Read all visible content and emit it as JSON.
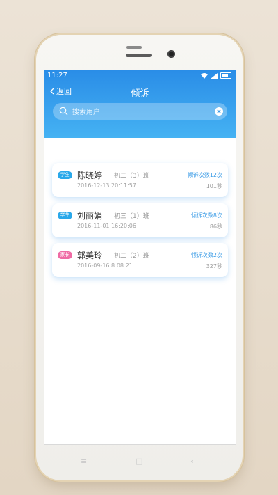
{
  "status": {
    "time": "11:27"
  },
  "nav": {
    "back_label": "返回",
    "title": "倾诉"
  },
  "search": {
    "placeholder": "搜索用户"
  },
  "records": [
    {
      "badge": "学生",
      "badge_color": "#29a8ea",
      "name": "陈晓婷",
      "class": "初二（3）班",
      "time": "2016-12-13  20:11:57",
      "count": "倾诉次数12次",
      "duration": "101秒"
    },
    {
      "badge": "学生",
      "badge_color": "#29a8ea",
      "name": "刘丽娟",
      "class": "初三（1）班",
      "time": "2016-11-01  16:20:06",
      "count": "倾诉次数8次",
      "duration": "86秒"
    },
    {
      "badge": "家长",
      "badge_color": "#ef6aa4",
      "name": "郭美玲",
      "class": "初二（2）班",
      "time": "2016-09-16  8:08:21",
      "count": "倾诉次数2次",
      "duration": "327秒"
    }
  ],
  "softkeys": {
    "menu": "≡",
    "home": "□",
    "back": "‹"
  },
  "colors": {
    "topbar_start": "#2a8de7",
    "topbar_end": "#45b2f3",
    "accent": "#3a9be6"
  }
}
